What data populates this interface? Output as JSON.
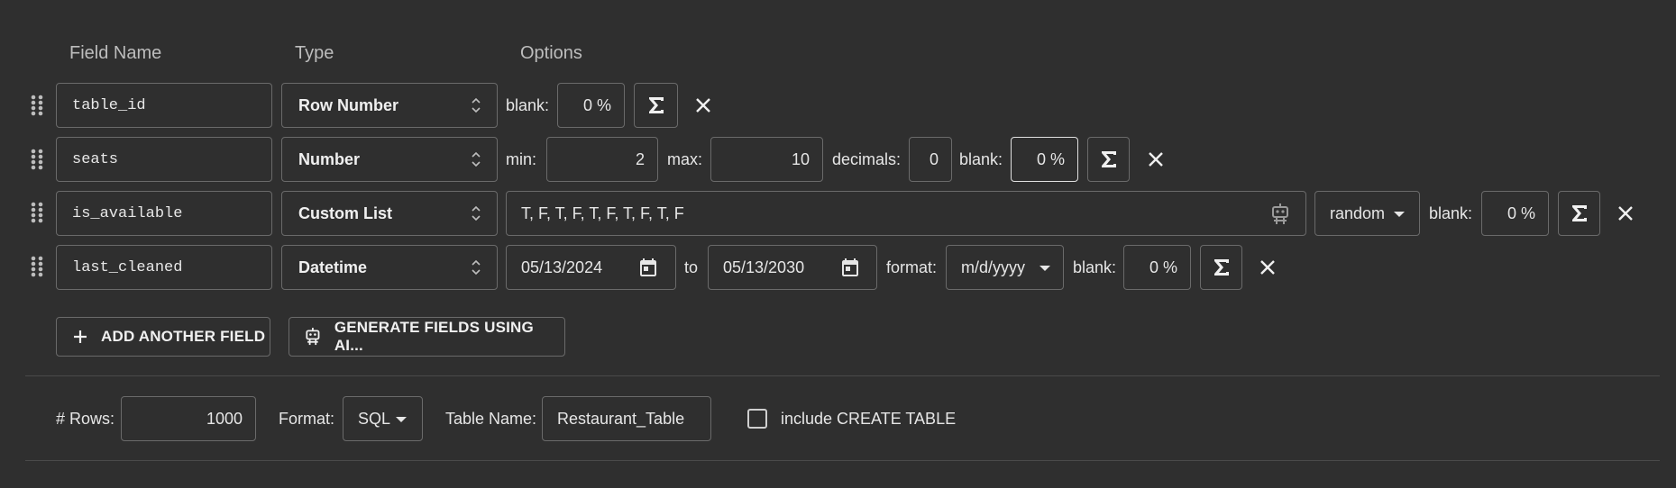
{
  "headers": {
    "field_name": "Field Name",
    "type": "Type",
    "options": "Options"
  },
  "rows": [
    {
      "name": "table_id",
      "type": "Row Number",
      "blank_label": "blank:",
      "blank_value": "0 %"
    },
    {
      "name": "seats",
      "type": "Number",
      "min_label": "min:",
      "min_value": "2",
      "max_label": "max:",
      "max_value": "10",
      "decimals_label": "decimals:",
      "decimals_value": "0",
      "blank_label": "blank:",
      "blank_value": "0 %"
    },
    {
      "name": "is_available",
      "type": "Custom List",
      "values": "T, F, T, F, T, F, T, F, T, F",
      "distribution": "random",
      "blank_label": "blank:",
      "blank_value": "0 %"
    },
    {
      "name": "last_cleaned",
      "type": "Datetime",
      "from_date": "05/13/2024",
      "to_label": "to",
      "to_date": "05/13/2030",
      "format_label": "format:",
      "format_value": "m/d/yyyy",
      "blank_label": "blank:",
      "blank_value": "0 %"
    }
  ],
  "actions": {
    "add_field": "ADD ANOTHER FIELD",
    "generate_ai": "GENERATE FIELDS USING AI..."
  },
  "footer": {
    "rows_label": "# Rows:",
    "rows_value": "1000",
    "format_label": "Format:",
    "format_value": "SQL",
    "table_name_label": "Table Name:",
    "table_name_value": "Restaurant_Table",
    "include_create_label": "include CREATE TABLE",
    "include_create_checked": false
  },
  "icons": {
    "drag": "drag-handle-icon",
    "sum": "sigma-icon",
    "remove": "close-icon",
    "calendar": "calendar-icon",
    "robot": "robot-icon",
    "plus": "plus-icon"
  }
}
